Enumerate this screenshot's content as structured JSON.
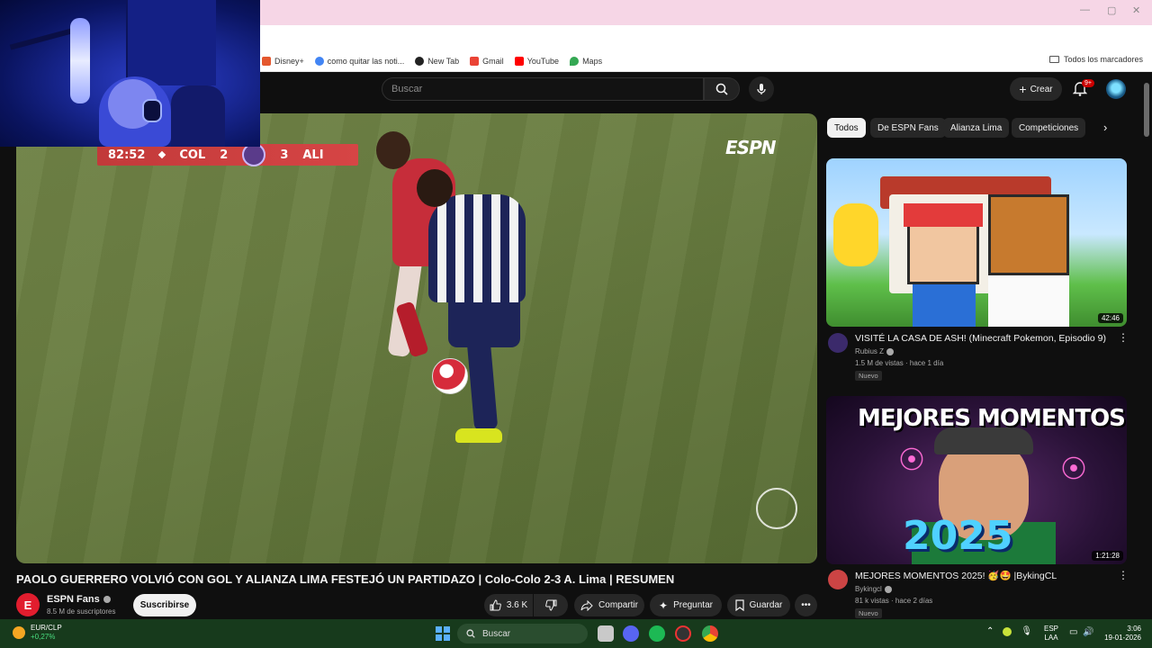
{
  "browser": {
    "bookmarks": [
      {
        "label": "Disney+",
        "color": "#e4572e"
      },
      {
        "label": "como quitar las noti...",
        "color": "#4285f4"
      },
      {
        "label": "New Tab",
        "color": "#222222"
      },
      {
        "label": "Gmail",
        "color": "#ea4335"
      },
      {
        "label": "YouTube",
        "color": "#ff0000"
      },
      {
        "label": "Maps",
        "color": "#34a853"
      }
    ],
    "all_bookmarks_label": "Todos los marcadores"
  },
  "youtube": {
    "search_placeholder": "Buscar",
    "create_label": "Crear",
    "notifications_badge": "9+"
  },
  "player": {
    "scoreboard": {
      "time": "82:52",
      "home_team": "COL",
      "home_score": "2",
      "away_score": "3",
      "away_team": "ALI"
    },
    "broadcaster": "ESPN",
    "league_logo": "SERIE RÍO DE LA PLATA"
  },
  "video": {
    "title": "PAOLO GUERRERO VOLVIÓ CON GOL Y ALIANZA LIMA FESTEJÓ UN PARTIDAZO | Colo-Colo 2-3 A. Lima | RESUMEN",
    "channel": {
      "name": "ESPN Fans",
      "subscribers": "8.5 M de suscriptores",
      "avatar_letter": "E"
    },
    "subscribe_label": "Suscribirse",
    "likes": "3.6 K",
    "share_label": "Compartir",
    "ask_label": "Preguntar",
    "save_label": "Guardar"
  },
  "sidebar": {
    "chips": [
      {
        "label": "Todos",
        "active": true
      },
      {
        "label": "De ESPN Fans",
        "active": false
      },
      {
        "label": "Alianza Lima",
        "active": false
      },
      {
        "label": "Competiciones",
        "active": false
      }
    ],
    "recommended": [
      {
        "title": "VISITÉ LA CASA DE ASH! (Minecraft Pokemon, Episodio 9)",
        "channel": "Rubius Z",
        "meta": "1.5 M de vistas · hace 1 día",
        "badge": "Nuevo",
        "duration": "42:46"
      },
      {
        "title": "MEJORES MOMENTOS 2025! 🥳🤩 |BykingCL",
        "channel": "Bykingcl",
        "meta": "81 k vistas · hace 2 días",
        "badge": "Nuevo",
        "duration": "1:21:28",
        "thumb_text": "MEJORES MOMENTOS",
        "thumb_year": "2025"
      }
    ]
  },
  "taskbar": {
    "weather_label": "EUR/CLP",
    "weather_change": "+0,27%",
    "search_label": "Buscar",
    "lang_1": "ESP",
    "lang_2": "LAA",
    "time": "3:06",
    "date": "19-01-2026"
  }
}
